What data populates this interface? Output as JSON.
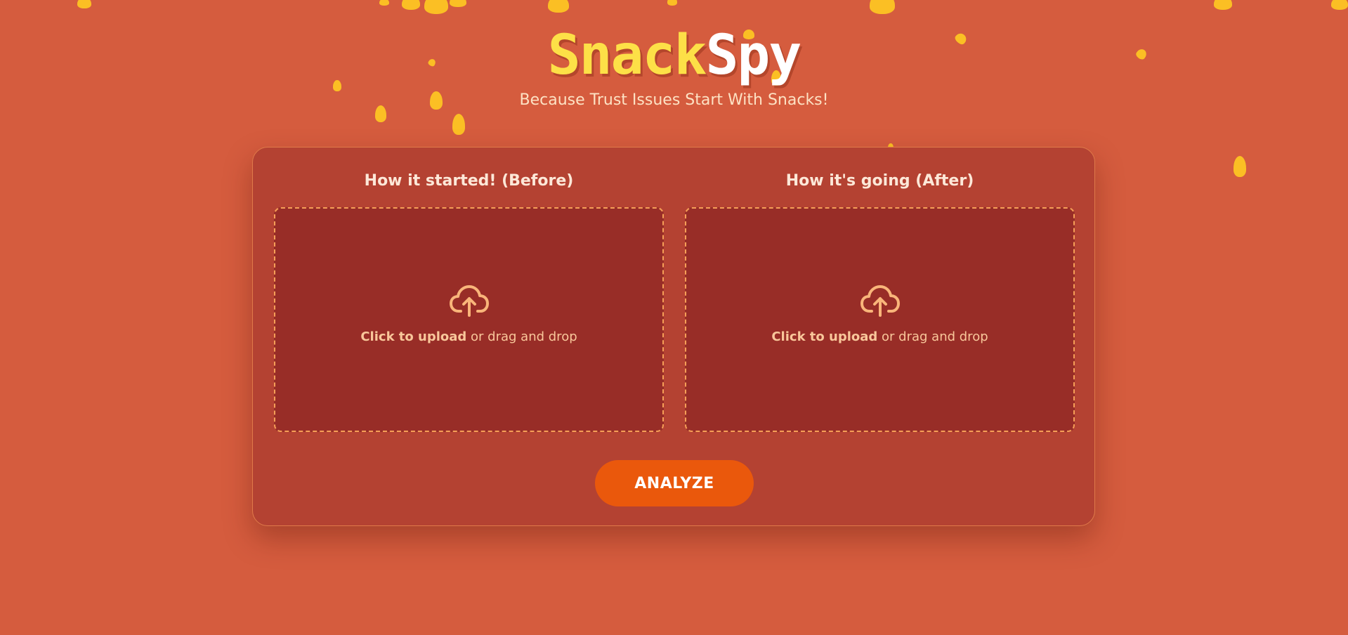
{
  "brand": {
    "logo_part1": "Snack",
    "logo_part2": "Spy",
    "tagline": "Because Trust Issues Start With Snacks!"
  },
  "uploads": [
    {
      "title": "How it started! (Before)",
      "cta": "Click to upload",
      "hint": " or drag and drop"
    },
    {
      "title": "How it's going (After)",
      "cta": "Click to upload",
      "hint": " or drag and drop"
    }
  ],
  "actions": {
    "analyze_label": "ANALYZE"
  },
  "colors": {
    "background": "#d55c3e",
    "card": "#b44232",
    "dropzone": "#982d27",
    "dropzone_border": "#f59e57",
    "accent_button": "#ea580c",
    "logo_yellow": "#fde047",
    "chips": "#fbbf24"
  },
  "icons": [
    "cloud-upload-icon",
    "cloud-upload-icon"
  ]
}
